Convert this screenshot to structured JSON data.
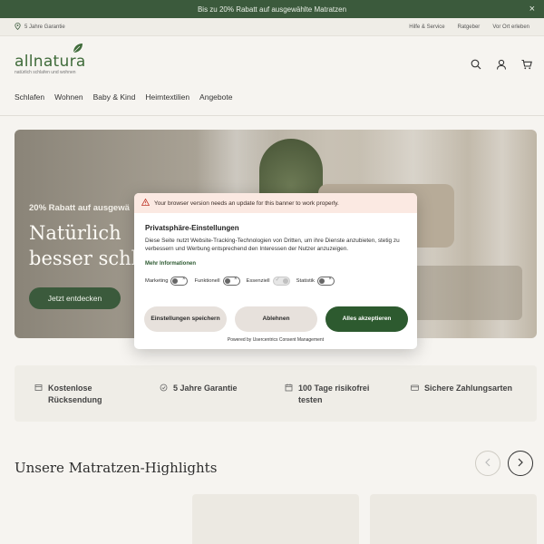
{
  "promo": {
    "text": "Bis zu 20% Rabatt auf ausgewählte Matratzen",
    "close_icon": "×"
  },
  "utility": {
    "guarantee": "5 Jahre Garantie",
    "links": [
      "Hilfe & Service",
      "Ratgeber",
      "Vor Ort erleben"
    ]
  },
  "header": {
    "logo_word": "allnatura",
    "logo_sub": "natürlich schlafen und wohnen",
    "icons": [
      "search-icon",
      "user-icon",
      "cart-icon"
    ],
    "nav": [
      "Schlafen",
      "Wohnen",
      "Baby & Kind",
      "Heimtextilien",
      "Angebote"
    ]
  },
  "hero": {
    "kicker": "20% Rabatt auf ausgewä",
    "title_line1": "Natürlich",
    "title_line2": "besser schl",
    "cta": "Jetzt entdecken"
  },
  "usps": [
    {
      "icon": "return-icon",
      "line1": "Kostenlose",
      "line2": "Rücksendung"
    },
    {
      "icon": "guarantee-icon",
      "line1": "5 Jahre Garantie",
      "line2": ""
    },
    {
      "icon": "trial-icon",
      "line1": "100 Tage risikofrei",
      "line2": "testen"
    },
    {
      "icon": "payment-icon",
      "line1": "Sichere Zahlungsarten",
      "line2": ""
    }
  ],
  "highlights": {
    "title": "Unsere Matratzen-Highlights"
  },
  "consent": {
    "warning": "Your browser version needs an update for this banner to work properly.",
    "title": "Privatsphäre-Einstellungen",
    "text": "Diese Seite nutzt Website-Tracking-Technologien von Dritten, um ihre Dienste anzubieten, stetig zu verbessern und Werbung entsprechend den Interessen der Nutzer anzuzeigen.",
    "more": "Mehr Informationen",
    "toggles": [
      {
        "label": "Marketing",
        "on": false
      },
      {
        "label": "Funktionell",
        "on": false
      },
      {
        "label": "Essenziell",
        "on": true
      },
      {
        "label": "Statistik",
        "on": false
      }
    ],
    "btn_settings": "Einstellungen speichern",
    "btn_decline": "Ablehnen",
    "btn_accept": "Alles akzeptieren",
    "powered": "Powered by Usercentrics Consent Management"
  },
  "colors": {
    "brand_green": "#3b5a3c",
    "accept_green": "#2d5a2f",
    "warning_bg": "#fbe9e2"
  }
}
